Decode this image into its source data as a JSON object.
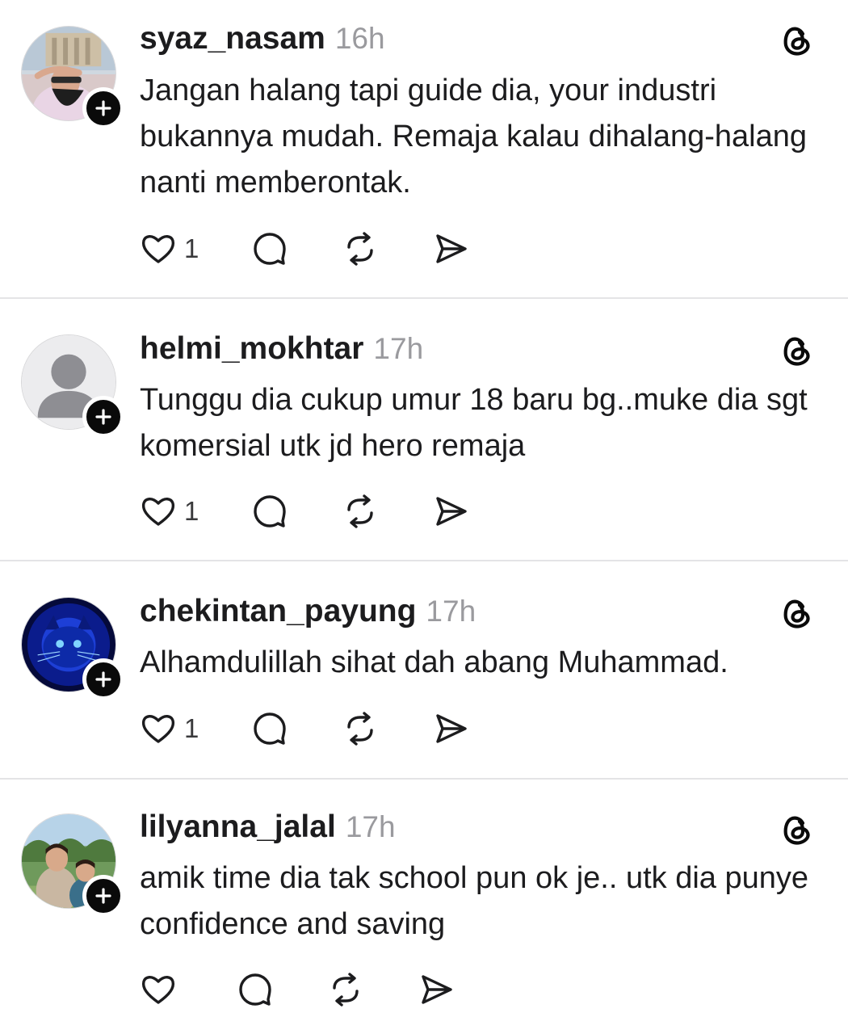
{
  "posts": [
    {
      "username": "syaz_nasam",
      "time": "16h",
      "text": "Jangan halang tapi guide dia, your industri bukannya mudah. Remaja kalau dihalang-halang nanti memberontak.",
      "likes": "1",
      "avatar": "photo-person-sunglasses"
    },
    {
      "username": "helmi_mokhtar",
      "time": "17h",
      "text": "Tunggu dia cukup umur 18 baru bg..muke dia sgt komersial utk jd hero remaja",
      "likes": "1",
      "avatar": "default-person-icon"
    },
    {
      "username": "chekintan_payung",
      "time": "17h",
      "text": "Alhamdulillah sihat dah abang Muhammad.",
      "likes": "1",
      "avatar": "photo-blue-cat"
    },
    {
      "username": "lilyanna_jalal",
      "time": "17h",
      "text": "amik time dia tak school pun ok je.. utk dia punye confidence and saving",
      "likes": "",
      "avatar": "photo-two-people-outdoors"
    }
  ],
  "icons": {
    "like": "heart-icon",
    "reply": "comment-icon",
    "repost": "repost-icon",
    "share": "send-icon",
    "app": "threads-icon",
    "follow": "plus-icon"
  },
  "colors": {
    "text": "#1c1c1e",
    "muted": "#9a9a9e",
    "divider": "#e4e4e6",
    "badge": "#0a0a0a"
  }
}
